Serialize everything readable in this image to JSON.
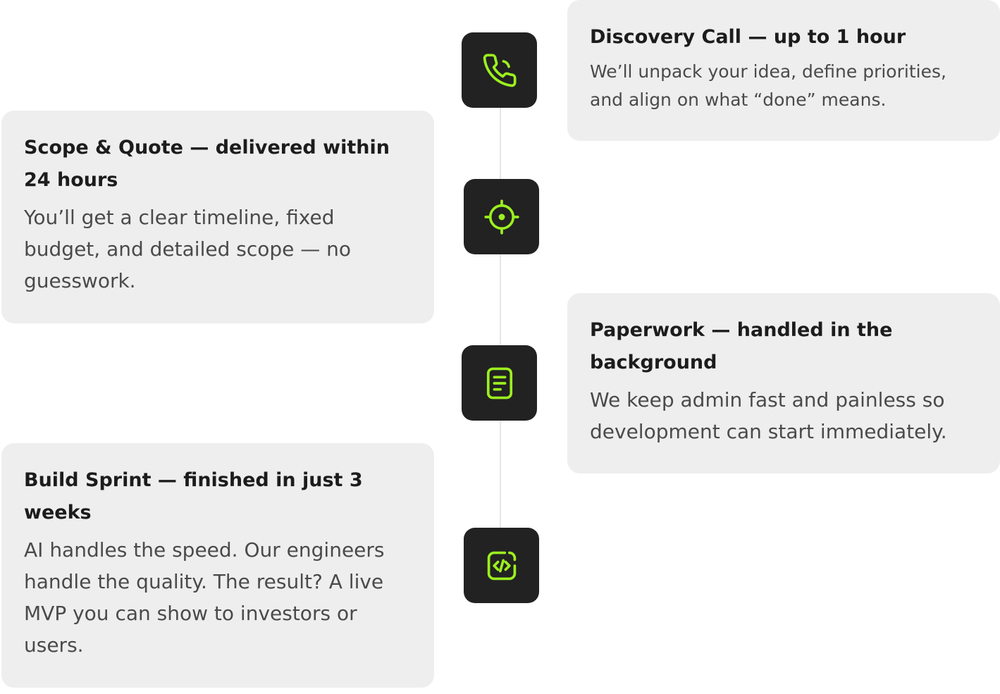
{
  "colors": {
    "accent": "#9cf01e",
    "icon_bg": "#222222",
    "card_bg": "#eeeeee",
    "title_text": "#1c1c1c",
    "body_text": "#4a4a4a",
    "timeline_line": "#e6e6e6"
  },
  "steps": [
    {
      "icon": "phone-icon",
      "title": "Discovery Call — up to 1 hour",
      "description": "We’ll unpack your idea, define priorities, and align on what “done” means."
    },
    {
      "icon": "target-icon",
      "title": "Scope & Quote — delivered within 24 hours",
      "description": "You’ll get a clear timeline, fixed budget, and detailed scope — no guesswork."
    },
    {
      "icon": "document-icon",
      "title": "Paperwork — handled in the background",
      "description": "We keep admin fast and painless so development can start immediately."
    },
    {
      "icon": "code-icon",
      "title": "Build Sprint — finished in just 3 weeks",
      "description": "AI handles the speed. Our engineers handle the quality. The result? A live MVP you can show to investors or users."
    }
  ]
}
